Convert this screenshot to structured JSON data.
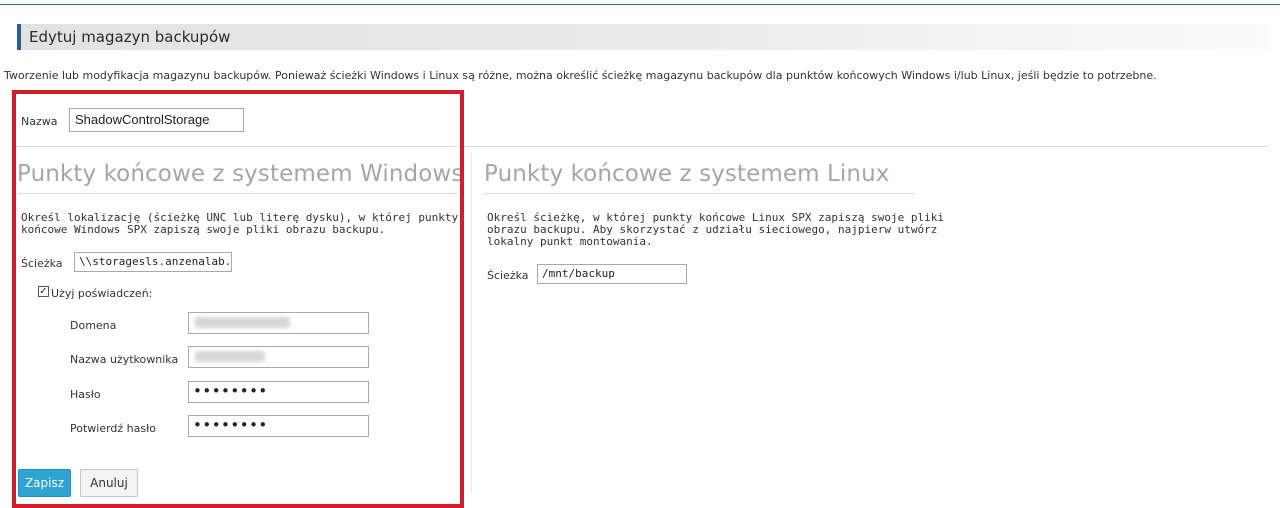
{
  "page": {
    "title": "Edytuj magazyn backupów",
    "description": "Tworzenie lub modyfikacja magazynu backupów. Ponieważ ścieżki Windows i Linux są różne, można określić ścieżkę magazynu backupów dla punktów końcowych Windows i/lub Linux, jeśli będzie to potrzebne."
  },
  "name_field": {
    "label": "Nazwa",
    "value": "ShadowControlStorage"
  },
  "windows": {
    "heading": "Punkty końcowe z systemem Windows",
    "help_line1": "Określ lokalizację (ścieżkę UNC lub literę dysku), w której punkty",
    "help_line2": "końcowe Windows SPX zapiszą swoje pliki obrazu backupu.",
    "path_label": "Ścieżka",
    "path_value": "\\\\storagesls.anzenalab.lo",
    "credentials_label": "Użyj poświadczeń:",
    "credentials_checked": true,
    "domain_label": "Domena",
    "username_label": "Nazwa użytkownika",
    "password_label": "Hasło",
    "password_value": "••••••••",
    "confirm_label": "Potwierdź hasło",
    "confirm_value": "••••••••"
  },
  "linux": {
    "heading": "Punkty końcowe z systemem Linux",
    "help_line1": "Określ ścieżkę, w której punkty końcowe Linux SPX zapiszą swoje pliki",
    "help_line2": "obrazu backupu. Aby skorzystać z udziału sieciowego, najpierw utwórz",
    "help_line3": "lokalny punkt montowania.",
    "path_label": "Ścieżka",
    "path_value": "/mnt/backup"
  },
  "buttons": {
    "save": "Zapisz",
    "cancel": "Anuluj"
  },
  "colors": {
    "accent": "#2c5f95",
    "primary_button": "#2fa4d2",
    "highlight_box": "#d01f2a",
    "heading_gray": "#a6a6a6"
  }
}
